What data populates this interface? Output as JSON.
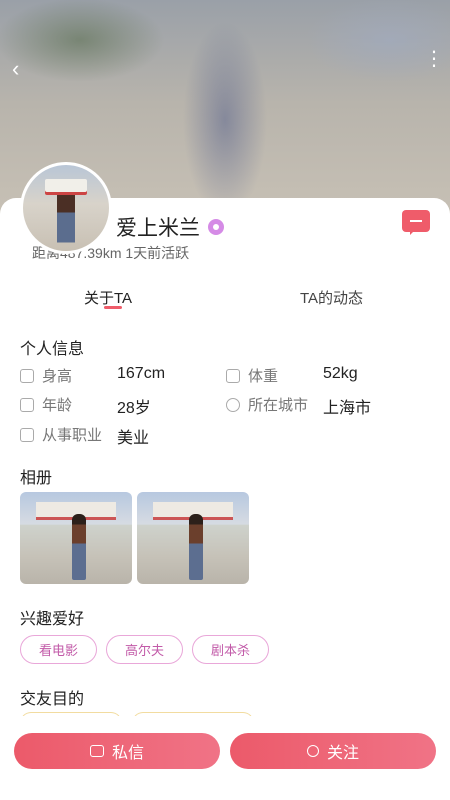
{
  "header": {
    "back_icon": "chevron-left-icon",
    "more_icon": "more-vertical-icon"
  },
  "profile": {
    "name": "爱上米兰",
    "meta": "距离487.39km  1天前活跃",
    "vip_icon": "vip-badge-icon",
    "chat_icon": "message-icon"
  },
  "tabs": {
    "about": "关于TA",
    "dynamics": "TA的动态"
  },
  "personal_info": {
    "title": "个人信息",
    "height_label": "身高",
    "height_value": "167cm",
    "weight_label": "体重",
    "weight_value": "52kg",
    "age_label": "年龄",
    "age_value": "28岁",
    "city_label": "所在城市",
    "city_value": "上海市",
    "job_label": "从事职业",
    "job_value": "美业"
  },
  "album": {
    "title": "相册"
  },
  "hobbies": {
    "title": "兴趣爱好",
    "items": [
      "看电影",
      "高尔夫",
      "剧本杀"
    ]
  },
  "purpose": {
    "title": "交友目的"
  },
  "actions": {
    "message": "私信",
    "follow": "关注"
  },
  "colors": {
    "accent": "#ef5c6a",
    "tag_border": "#e9a7d9",
    "tag_text": "#c25aa8"
  }
}
